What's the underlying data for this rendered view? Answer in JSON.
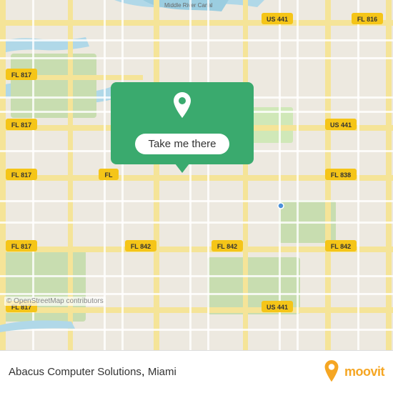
{
  "map": {
    "attribution": "© OpenStreetMap contributors",
    "popup": {
      "button_label": "Take me there",
      "location_icon": "📍"
    }
  },
  "bottom_bar": {
    "location_name": "Abacus Computer Solutions",
    "location_city": "Miami",
    "moovit_text": "moovit"
  },
  "colors": {
    "popup_bg": "#3aaa6e",
    "road_major": "#f5e6a3",
    "road_minor": "#ffffff",
    "water": "#b0d8e8",
    "green_area": "#c8ddb0",
    "map_bg": "#ede9e0",
    "accent": "#f5a623"
  },
  "route_labels": [
    {
      "id": "fl817_top",
      "text": "FL 817"
    },
    {
      "id": "fl816",
      "text": "FL 816"
    },
    {
      "id": "us441_top",
      "text": "US 441"
    },
    {
      "id": "fl817_mid",
      "text": "FL 817"
    },
    {
      "id": "us441_mid",
      "text": "US 441"
    },
    {
      "id": "fl817_left",
      "text": "FL 817"
    },
    {
      "id": "fl838",
      "text": "FL 838"
    },
    {
      "id": "fl817_bot1",
      "text": "FL 817"
    },
    {
      "id": "fl842_left",
      "text": "FL 842"
    },
    {
      "id": "fl842_mid",
      "text": "FL 842"
    },
    {
      "id": "fl842_right",
      "text": "FL 842"
    },
    {
      "id": "fl817_bot2",
      "text": "FL 817"
    },
    {
      "id": "us441_bot",
      "text": "US 441"
    },
    {
      "id": "fl_center",
      "text": "FL"
    }
  ]
}
